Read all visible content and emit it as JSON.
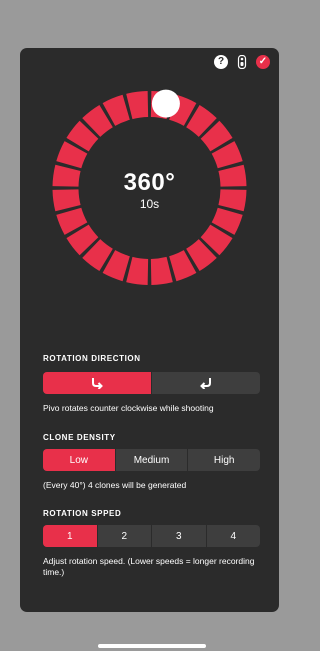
{
  "dial": {
    "angle": "360°",
    "duration": "10s",
    "segment_count": 24
  },
  "top_icons": {
    "help": "?",
    "remote": "▯",
    "confirm": "✓"
  },
  "rotation_direction": {
    "title": "ROTATION DIRECTION",
    "options": [
      {
        "icon": "↪"
      },
      {
        "icon": "↩"
      }
    ],
    "selected": 0,
    "description": "Pivo rotates counter clockwise while shooting"
  },
  "clone_density": {
    "title": "CLONE DENSITY",
    "options": [
      "Low",
      "Medium",
      "High"
    ],
    "selected": 0,
    "description": "(Every 40°) 4 clones will be generated"
  },
  "rotation_speed": {
    "title": "ROTATION SPPED",
    "options": [
      "1",
      "2",
      "3",
      "4"
    ],
    "selected": 0,
    "description": "Adjust rotation speed. (Lower speeds = longer recording time.)"
  },
  "colors": {
    "accent": "#e8304a",
    "panel": "#2b2b2b",
    "segment_off": "#3e3e3e",
    "backdrop": "#9a9a9a"
  }
}
